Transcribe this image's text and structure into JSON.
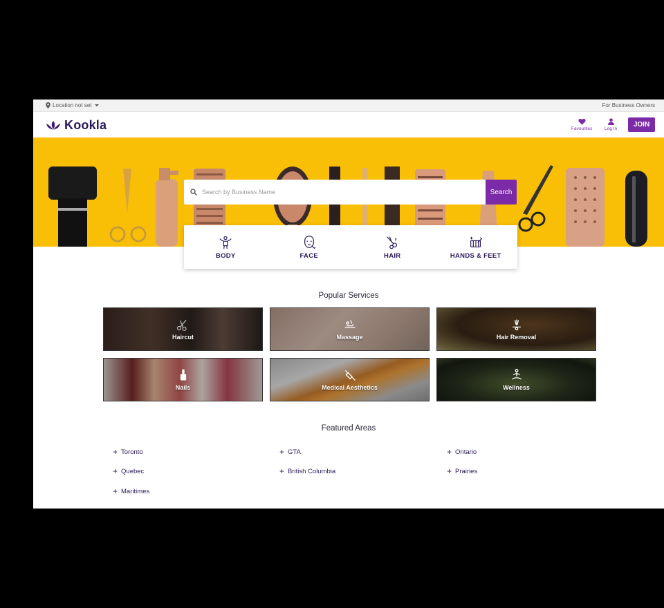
{
  "topbar": {
    "location": "Location not set",
    "business_link": "For Business Owners"
  },
  "header": {
    "brand": "Kookla",
    "favourites": "Favourites",
    "login": "Log In",
    "join": "JOIN"
  },
  "hero": {
    "search_placeholder": "Search by Business Name",
    "search_button": "Search"
  },
  "categories": [
    {
      "label": "BODY",
      "icon": "body-icon"
    },
    {
      "label": "FACE",
      "icon": "face-icon"
    },
    {
      "label": "HAIR",
      "icon": "hair-icon"
    },
    {
      "label": "HANDS & FEET",
      "icon": "hands-feet-icon"
    }
  ],
  "popular": {
    "title": "Popular Services",
    "tiles": [
      {
        "label": "Haircut",
        "icon": "scissors-icon"
      },
      {
        "label": "Massage",
        "icon": "massage-icon"
      },
      {
        "label": "Hair Removal",
        "icon": "hair-removal-icon"
      },
      {
        "label": "Nails",
        "icon": "nail-polish-icon"
      },
      {
        "label": "Medical Aesthetics",
        "icon": "syringe-icon"
      },
      {
        "label": "Wellness",
        "icon": "meditation-icon"
      }
    ]
  },
  "featured": {
    "title": "Featured Areas",
    "areas": [
      "Toronto",
      "GTA",
      "Ontario",
      "Quebec",
      "British Columbia",
      "Prairies",
      "Maritimes"
    ]
  },
  "colors": {
    "accent": "#7b2aa8",
    "navy": "#2b1a58",
    "hero_yellow": "#f9bf07"
  }
}
